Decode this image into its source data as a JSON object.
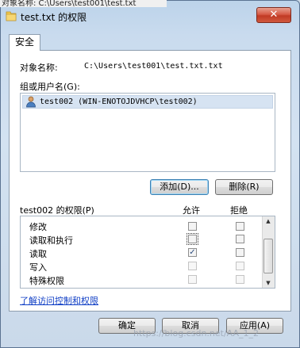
{
  "behind_text": "对象名称:    C:\\Users\\test001\\test.txt",
  "window": {
    "title": "test.txt 的权限",
    "close_symbol": "✕"
  },
  "tab": {
    "label": "安全"
  },
  "object": {
    "label": "对象名称:",
    "value": "C:\\Users\\test001\\test.txt.txt"
  },
  "groups": {
    "label": "组或用户名(G):",
    "items": [
      {
        "name": "test002 (WIN-ENOTOJDVHCP\\test002)"
      }
    ]
  },
  "buttons": {
    "add": "添加(D)...",
    "remove": "删除(R)",
    "ok": "确定",
    "cancel": "取消",
    "apply": "应用(A)"
  },
  "permissions": {
    "label": "test002 的权限(P)",
    "allow_header": "允许",
    "deny_header": "拒绝",
    "rows": [
      {
        "name": "修改",
        "allow": false,
        "deny": false
      },
      {
        "name": "读取和执行",
        "allow": false,
        "deny": false
      },
      {
        "name": "读取",
        "allow": true,
        "deny": false
      },
      {
        "name": "写入",
        "allow": false,
        "deny": false
      },
      {
        "name": "特殊权限",
        "allow": false,
        "deny": false
      }
    ]
  },
  "link": {
    "text": "了解访问控制和权限"
  },
  "watermark": "https://blog.csdn.net/AA_1_2"
}
